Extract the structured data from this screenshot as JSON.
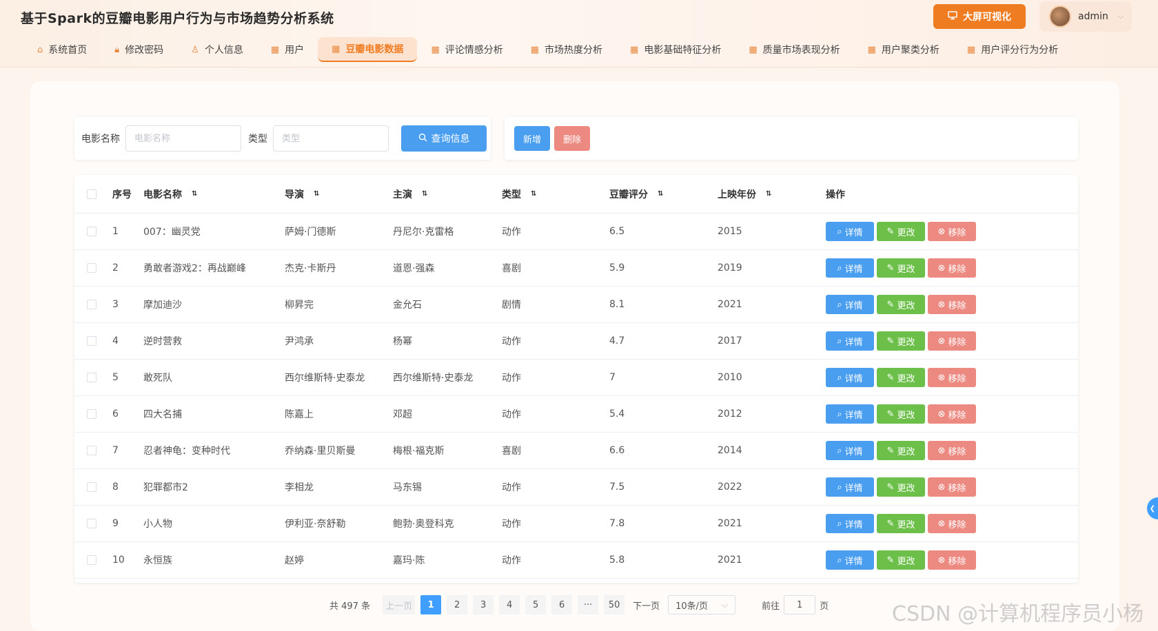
{
  "app": {
    "title": "基于Spark的豆瓣电影用户行为与市场趋势分析系统",
    "big_screen_label": "大屏可视化",
    "user": "admin"
  },
  "nav": [
    {
      "label": "系统首页",
      "icon": "home-icon"
    },
    {
      "label": "修改密码",
      "icon": "lock-icon"
    },
    {
      "label": "个人信息",
      "icon": "user-icon"
    },
    {
      "label": "用户",
      "icon": "grid-icon"
    },
    {
      "label": "豆瓣电影数据",
      "icon": "grid-icon",
      "active": true
    },
    {
      "label": "评论情感分析",
      "icon": "grid-icon"
    },
    {
      "label": "市场热度分析",
      "icon": "grid-icon"
    },
    {
      "label": "电影基础特征分析",
      "icon": "grid-icon"
    },
    {
      "label": "质量市场表现分析",
      "icon": "grid-icon"
    },
    {
      "label": "用户聚类分析",
      "icon": "grid-icon"
    },
    {
      "label": "用户评分行为分析",
      "icon": "grid-icon"
    }
  ],
  "search": {
    "name_label": "电影名称",
    "name_placeholder": "电影名称",
    "type_label": "类型",
    "type_placeholder": "类型",
    "query_label": "查询信息"
  },
  "actions": {
    "add_label": "新增",
    "delete_label": "删除"
  },
  "table": {
    "columns": [
      "序号",
      "电影名称",
      "导演",
      "主演",
      "类型",
      "豆瓣评分",
      "上映年份",
      "操作"
    ],
    "rows": [
      [
        "1",
        "007：幽灵党",
        "萨姆·门德斯",
        "丹尼尔·克雷格",
        "动作",
        "6.5",
        "2015"
      ],
      [
        "2",
        "勇敢者游戏2：再战巅峰",
        "杰克·卡斯丹",
        "道恩·强森",
        "喜剧",
        "5.9",
        "2019"
      ],
      [
        "3",
        "摩加迪沙",
        "柳昇完",
        "金允石",
        "剧情",
        "8.1",
        "2021"
      ],
      [
        "4",
        "逆时营救",
        "尹鸿承",
        "杨幂",
        "动作",
        "4.7",
        "2017"
      ],
      [
        "5",
        "敢死队",
        "西尔维斯特·史泰龙",
        "西尔维斯特·史泰龙",
        "动作",
        "7",
        "2010"
      ],
      [
        "6",
        "四大名捕",
        "陈嘉上",
        "邓超",
        "动作",
        "5.4",
        "2012"
      ],
      [
        "7",
        "忍者神龟：变种时代",
        "乔纳森·里贝斯曼",
        "梅根·福克斯",
        "喜剧",
        "6.6",
        "2014"
      ],
      [
        "8",
        "犯罪都市2",
        "李相龙",
        "马东锡",
        "动作",
        "7.5",
        "2022"
      ],
      [
        "9",
        "小人物",
        "伊利亚·奈舒勒",
        "鲍勃·奥登科克",
        "动作",
        "7.8",
        "2021"
      ],
      [
        "10",
        "永恒族",
        "赵婷",
        "嘉玛·陈",
        "动作",
        "5.8",
        "2021"
      ]
    ],
    "ops": {
      "detail": "详情",
      "edit": "更改",
      "remove": "移除"
    }
  },
  "pagination": {
    "total": "共 497 条",
    "prev": "上一页",
    "pages": [
      "1",
      "2",
      "3",
      "4",
      "5",
      "6",
      "···",
      "50"
    ],
    "current": "1",
    "next": "下一页",
    "page_size": "10条/页",
    "goto_label": "前往",
    "goto_value": "1",
    "goto_suffix": "页"
  },
  "watermark": "CSDN @计算机程序员小杨",
  "colors": {
    "accent": "#f07c22",
    "primary": "#4a9ef0",
    "success": "#6cc04a",
    "danger": "#ec8a82"
  }
}
